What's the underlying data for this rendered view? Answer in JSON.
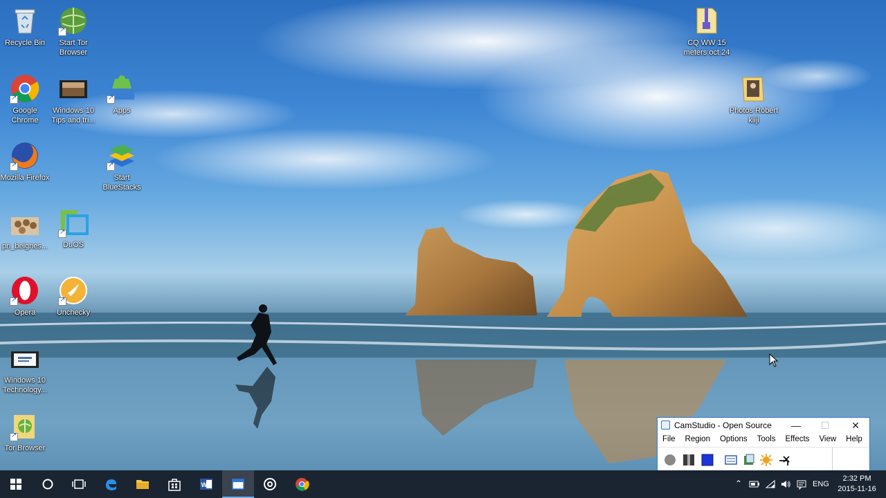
{
  "desktop": {
    "icons": {
      "recycle_bin": "Recycle Bin",
      "start_tor_browser": "Start Tor Browser",
      "google_chrome": "Google Chrome",
      "windows10_tips": "Windows 10 Tips and tri...",
      "apps": "Apps",
      "mozilla_firefox": "Mozilla Firefox",
      "start_bluestacks": "Start BlueStacks",
      "beignets": "pn_beignes...",
      "duos": "DuOS",
      "opera": "Opera",
      "unchecky": "Unchecky",
      "windows10_technology": "Windows 10 Technology...",
      "tor_browser": "Tor Browser",
      "cq_ww": "CQ WW 15 meters oct 24",
      "photos_robert": "Photos Robert kiiji"
    }
  },
  "camstudio": {
    "title": "CamStudio - Open Source",
    "menu": [
      "File",
      "Region",
      "Options",
      "Tools",
      "Effects",
      "View",
      "Help"
    ],
    "toolbar_icons": [
      "record-icon",
      "pause-icon",
      "stop-icon",
      "region-icon",
      "camera-icon",
      "settings-sun-icon",
      "annotate-icon"
    ],
    "colors": {
      "accent": "#2b79d8",
      "stop": "#1c34d8",
      "sun": "#f2a21a"
    }
  },
  "taskbar": {
    "language": "ENG",
    "time": "2:32 PM",
    "date": "2015-11-16",
    "apps": [
      "start-button",
      "cortana",
      "task-view",
      "edge",
      "file-explorer",
      "store",
      "word",
      "camstudio",
      "media",
      "chrome"
    ]
  }
}
